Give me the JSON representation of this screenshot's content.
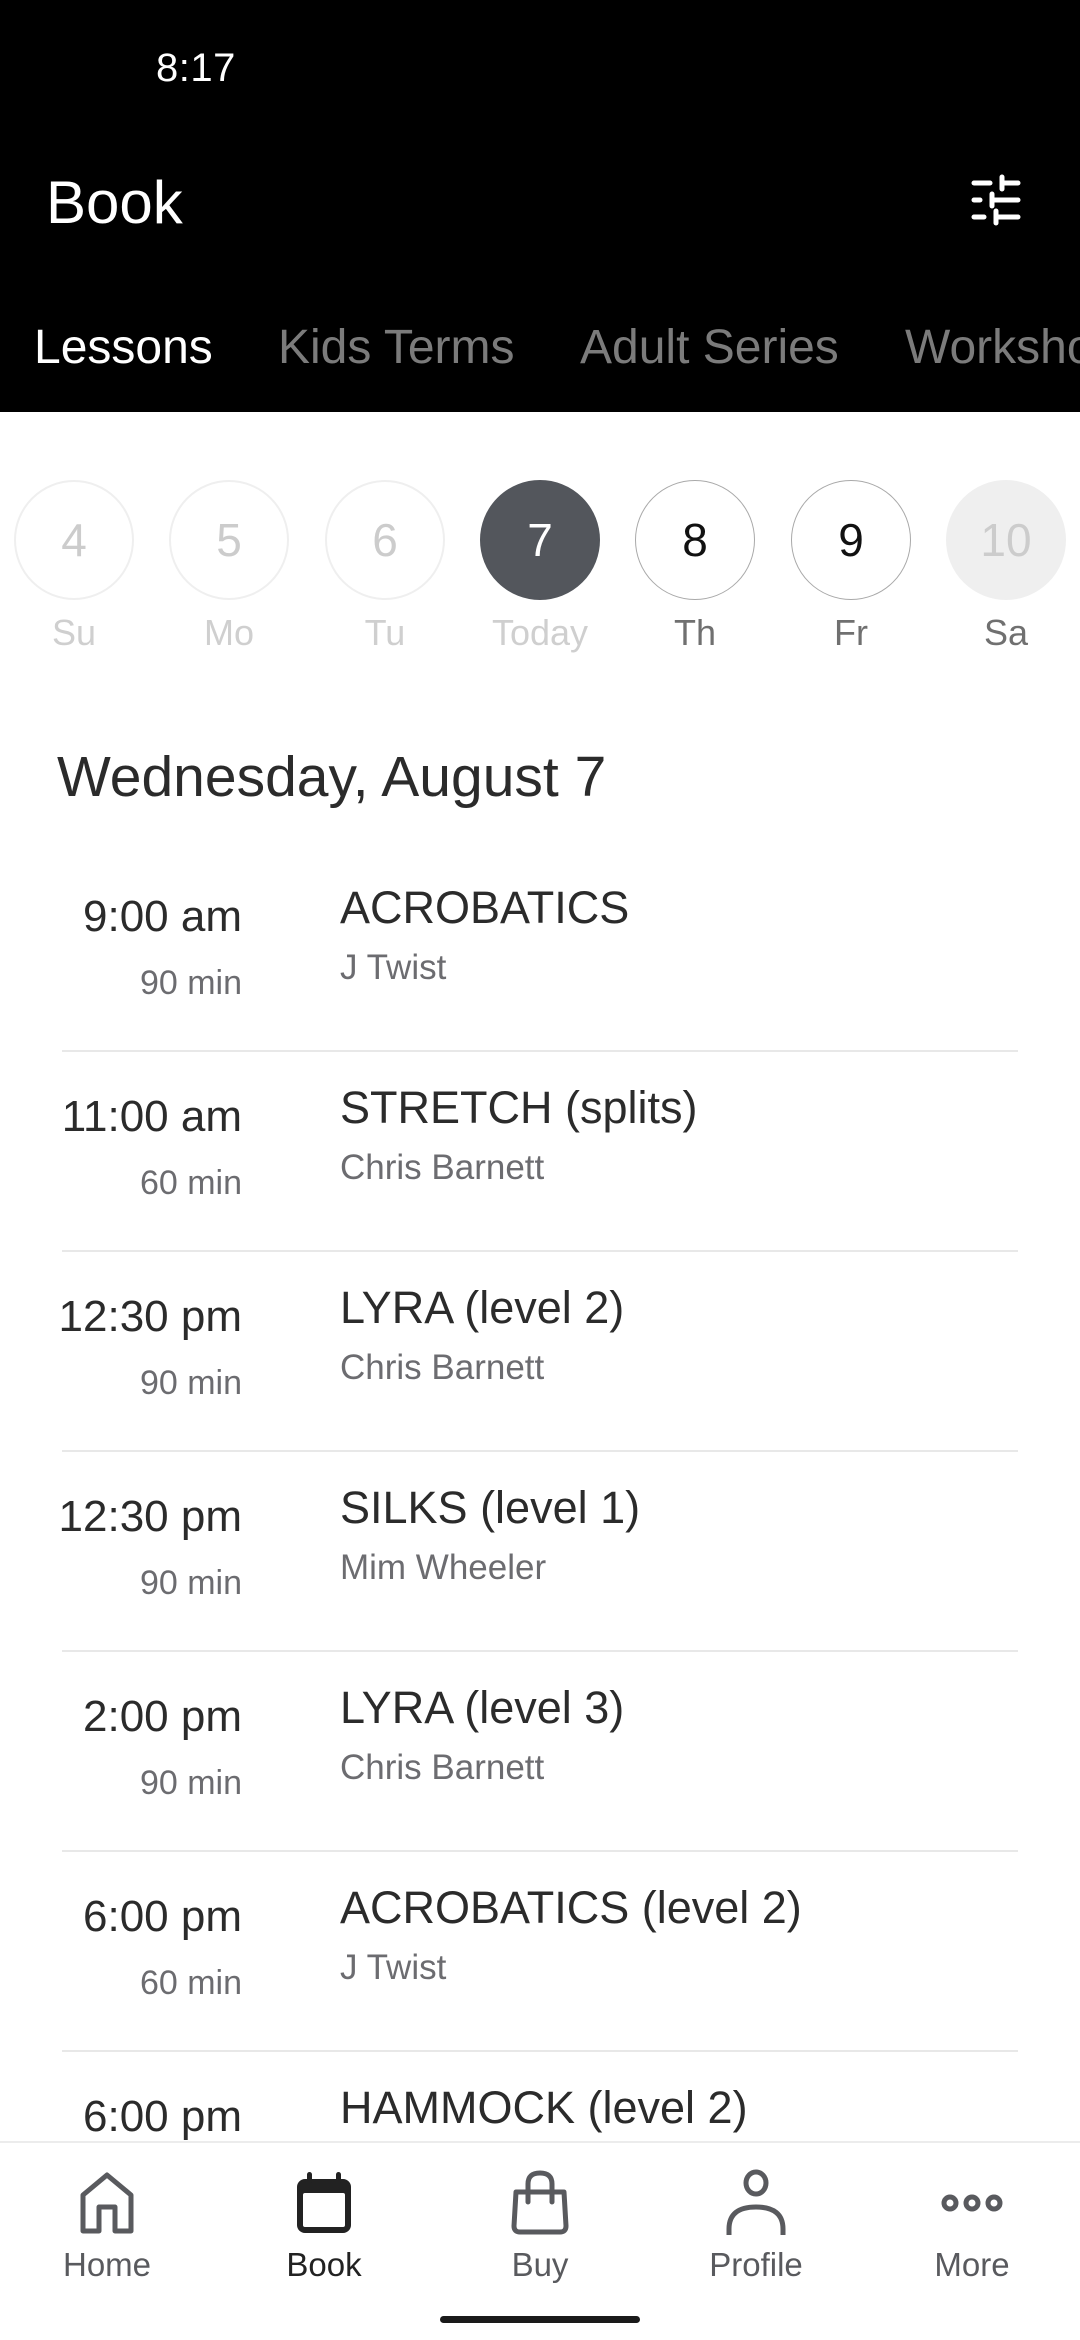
{
  "status_bar": {
    "time": "8:17"
  },
  "header": {
    "title": "Book",
    "filter_icon": "sliders-icon"
  },
  "tabs": [
    {
      "label": "Lessons",
      "active": true
    },
    {
      "label": "Kids Terms",
      "active": false
    },
    {
      "label": "Adult Series",
      "active": false
    },
    {
      "label": "Workshops",
      "active": false
    }
  ],
  "date_strip": [
    {
      "day": "4",
      "label": "Su",
      "state": "past"
    },
    {
      "day": "5",
      "label": "Mo",
      "state": "past"
    },
    {
      "day": "6",
      "label": "Tu",
      "state": "past"
    },
    {
      "day": "7",
      "label": "Today",
      "state": "selected"
    },
    {
      "day": "8",
      "label": "Th",
      "state": "future"
    },
    {
      "day": "9",
      "label": "Fr",
      "state": "future"
    },
    {
      "day": "10",
      "label": "Sa",
      "state": "unavailable"
    }
  ],
  "selected_date_heading": "Wednesday, August 7",
  "classes": [
    {
      "time": "9:00 am",
      "duration": "90 min",
      "name": "ACROBATICS",
      "instructor": "J Twist"
    },
    {
      "time": "11:00 am",
      "duration": "60 min",
      "name": "STRETCH (splits)",
      "instructor": "Chris Barnett"
    },
    {
      "time": "12:30 pm",
      "duration": "90 min",
      "name": "LYRA (level 2)",
      "instructor": "Chris Barnett"
    },
    {
      "time": "12:30 pm",
      "duration": "90 min",
      "name": "SILKS (level 1)",
      "instructor": "Mim Wheeler"
    },
    {
      "time": "2:00 pm",
      "duration": "90 min",
      "name": "LYRA (level 3)",
      "instructor": "Chris Barnett"
    },
    {
      "time": "6:00 pm",
      "duration": "60 min",
      "name": "ACROBATICS (level 2)",
      "instructor": "J Twist"
    },
    {
      "time": "6:00 pm",
      "duration": "",
      "name": "HAMMOCK (level 2)",
      "instructor": ""
    }
  ],
  "bottom_nav": [
    {
      "label": "Home",
      "icon": "home-icon",
      "active": false
    },
    {
      "label": "Book",
      "icon": "calendar-icon",
      "active": true
    },
    {
      "label": "Buy",
      "icon": "shopping-bag-icon",
      "active": false
    },
    {
      "label": "Profile",
      "icon": "person-icon",
      "active": false
    },
    {
      "label": "More",
      "icon": "more-dots-icon",
      "active": false
    }
  ],
  "colors": {
    "header_bg": "#000000",
    "selected_day": "#53565c",
    "text_primary": "#2b2b2b",
    "text_secondary": "#6c6c70",
    "tab_inactive": "#7b7b7b"
  }
}
